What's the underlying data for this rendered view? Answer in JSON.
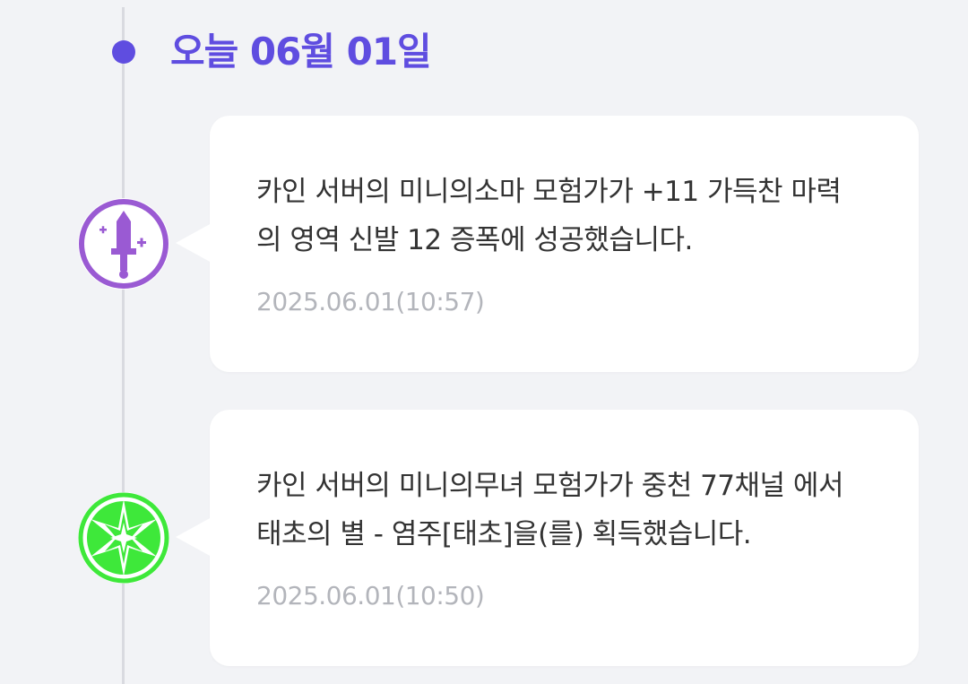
{
  "date_header": {
    "label": "오늘 06월 01일",
    "color": "#5f4de0"
  },
  "events": [
    {
      "icon": "purple-sword-icon",
      "accent": "#9a5ad3",
      "message": "카인 서버의 미니의소마 모험가가 +11 가득찬 마력의 영역 신발 12 증폭에 성공했습니다.",
      "timestamp": "2025.06.01(10:57)"
    },
    {
      "icon": "green-star-burst-icon",
      "accent": "#3ee83a",
      "message": "카인 서버의 미니의무녀 모험가가 중천 77채널 에서 태초의 별 - 염주[태초]을(를) 획득했습니다.",
      "timestamp": "2025.06.01(10:50)"
    }
  ]
}
